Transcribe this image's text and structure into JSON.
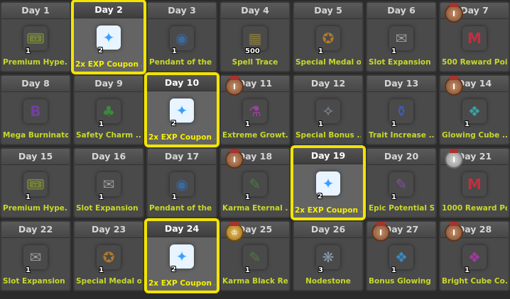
{
  "days": [
    {
      "label": "Day 1",
      "item": "Premium Hype...",
      "count": "1",
      "icon": "ticket-icon",
      "color": "#7a8a3a",
      "glyph": "🎟",
      "selected": false,
      "medal": ""
    },
    {
      "label": "Day 2",
      "item": "2x EXP Coupon ...",
      "count": "2",
      "icon": "exp-coupon-icon",
      "color": "#3aa0ff",
      "glyph": "✦",
      "selected": true,
      "medal": ""
    },
    {
      "label": "Day 3",
      "item": "Pendant of the ...",
      "count": "1",
      "icon": "pendant-icon",
      "color": "#3a6aa0",
      "glyph": "◉",
      "selected": false,
      "medal": ""
    },
    {
      "label": "Day 4",
      "item": "Spell Trace",
      "count": "500",
      "icon": "spell-trace-icon",
      "color": "#8a7a40",
      "glyph": "▦",
      "selected": false,
      "medal": ""
    },
    {
      "label": "Day 5",
      "item": "Special Medal o...",
      "count": "1",
      "icon": "medal-item-icon",
      "color": "#b07a2a",
      "glyph": "✪",
      "selected": false,
      "medal": ""
    },
    {
      "label": "Day 6",
      "item": "Slot Expansion ...",
      "count": "1",
      "icon": "envelope-icon",
      "color": "#9a9a9a",
      "glyph": "✉",
      "selected": false,
      "medal": ""
    },
    {
      "label": "Day 7",
      "item": "500 Reward Poi...",
      "count": "",
      "icon": "reward-points-icon",
      "color": "#c03040",
      "glyph": "M",
      "selected": false,
      "medal": "bronze"
    },
    {
      "label": "Day 8",
      "item": "Mega Burninator",
      "count": "",
      "icon": "burning-icon",
      "color": "#7040a0",
      "glyph": "B",
      "selected": false,
      "medal": ""
    },
    {
      "label": "Day 9",
      "item": "Safety Charm ...",
      "count": "1",
      "icon": "charm-icon",
      "color": "#3a8a3a",
      "glyph": "♣",
      "selected": false,
      "medal": ""
    },
    {
      "label": "Day 10",
      "item": "2x EXP Coupon ...",
      "count": "2",
      "icon": "exp-coupon-icon",
      "color": "#3aa0ff",
      "glyph": "✦",
      "selected": true,
      "medal": ""
    },
    {
      "label": "Day 11",
      "item": "Extreme Growt...",
      "count": "1",
      "icon": "potion-icon",
      "color": "#a040a0",
      "glyph": "⚗",
      "selected": false,
      "medal": "bronze"
    },
    {
      "label": "Day 12",
      "item": "Special Bonus ...",
      "count": "1",
      "icon": "scroll-icon",
      "color": "#8a9ab0",
      "glyph": "✧",
      "selected": false,
      "medal": ""
    },
    {
      "label": "Day 13",
      "item": "Trait Increase ...",
      "count": "1",
      "icon": "flask-icon",
      "color": "#4060c0",
      "glyph": "⚱",
      "selected": false,
      "medal": ""
    },
    {
      "label": "Day 14",
      "item": "Glowing Cube ...",
      "count": "1",
      "icon": "cube-icon",
      "color": "#3aa0a0",
      "glyph": "❖",
      "selected": false,
      "medal": "bronze"
    },
    {
      "label": "Day 15",
      "item": "Premium Hype...",
      "count": "1",
      "icon": "ticket-icon",
      "color": "#7a8a3a",
      "glyph": "🎟",
      "selected": false,
      "medal": ""
    },
    {
      "label": "Day 16",
      "item": "Slot Expansion ...",
      "count": "1",
      "icon": "envelope-icon",
      "color": "#9a9a9a",
      "glyph": "✉",
      "selected": false,
      "medal": ""
    },
    {
      "label": "Day 17",
      "item": "Pendant of the ...",
      "count": "1",
      "icon": "pendant-icon",
      "color": "#3a6aa0",
      "glyph": "◉",
      "selected": false,
      "medal": ""
    },
    {
      "label": "Day 18",
      "item": "Karma Eternal ...",
      "count": "1",
      "icon": "karma-scroll-icon",
      "color": "#507a40",
      "glyph": "✎",
      "selected": false,
      "medal": "bronze"
    },
    {
      "label": "Day 19",
      "item": "2x EXP Coupon ...",
      "count": "2",
      "icon": "exp-coupon-icon",
      "color": "#3aa0ff",
      "glyph": "✦",
      "selected": true,
      "medal": ""
    },
    {
      "label": "Day 20",
      "item": "Epic Potential S...",
      "count": "1",
      "icon": "potential-scroll-icon",
      "color": "#8050a0",
      "glyph": "✎",
      "selected": false,
      "medal": ""
    },
    {
      "label": "Day 21",
      "item": "1000 Reward Po...",
      "count": "",
      "icon": "reward-points-icon",
      "color": "#c03040",
      "glyph": "M",
      "selected": false,
      "medal": "silver"
    },
    {
      "label": "Day 22",
      "item": "Slot Expansion ...",
      "count": "1",
      "icon": "envelope-icon",
      "color": "#9a9a9a",
      "glyph": "✉",
      "selected": false,
      "medal": ""
    },
    {
      "label": "Day 23",
      "item": "Special Medal o...",
      "count": "1",
      "icon": "medal-item-icon",
      "color": "#b07a2a",
      "glyph": "✪",
      "selected": false,
      "medal": ""
    },
    {
      "label": "Day 24",
      "item": "2x EXP Coupon ...",
      "count": "2",
      "icon": "exp-coupon-icon",
      "color": "#3aa0ff",
      "glyph": "✦",
      "selected": true,
      "medal": ""
    },
    {
      "label": "Day 25",
      "item": "Karma Black Re...",
      "count": "1",
      "icon": "karma-scroll-icon",
      "color": "#507a40",
      "glyph": "✎",
      "selected": false,
      "medal": "gold"
    },
    {
      "label": "Day 26",
      "item": "Nodestone",
      "count": "3",
      "icon": "nodestone-icon",
      "color": "#8a9aaa",
      "glyph": "❋",
      "selected": false,
      "medal": ""
    },
    {
      "label": "Day 27",
      "item": "Bonus Glowing ...",
      "count": "1",
      "icon": "cube-icon",
      "color": "#3a8ac0",
      "glyph": "❖",
      "selected": false,
      "medal": "bronze"
    },
    {
      "label": "Day 28",
      "item": "Bright Cube Co...",
      "count": "1",
      "icon": "cube-icon",
      "color": "#a03aa0",
      "glyph": "❖",
      "selected": false,
      "medal": "bronze"
    }
  ],
  "medal_glyphs": {
    "bronze": "I",
    "silver": "I",
    "gold": "♔"
  }
}
